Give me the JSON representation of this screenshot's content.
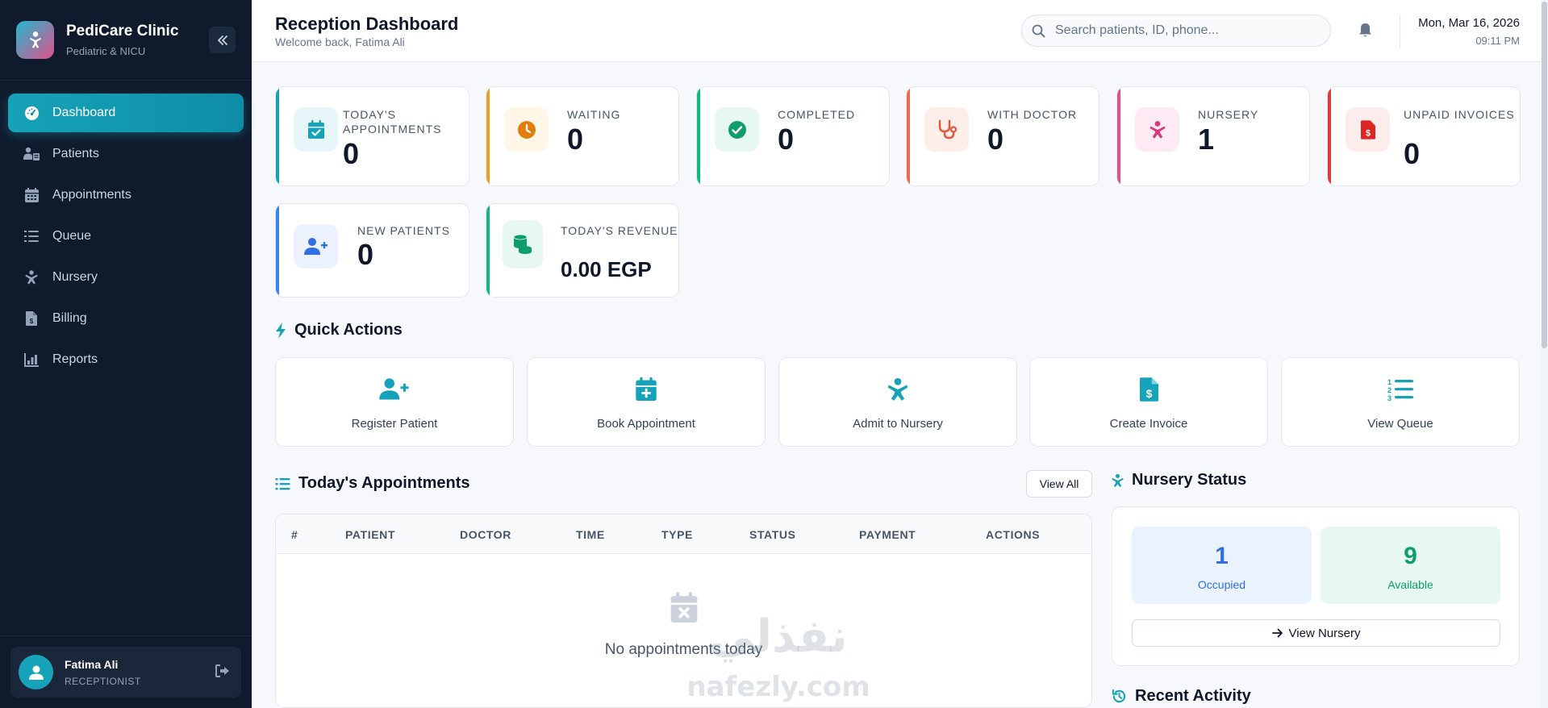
{
  "brand": {
    "name": "PediCare Clinic",
    "subtitle": "Pediatric & NICU"
  },
  "sidebar": {
    "items": [
      {
        "label": "Dashboard",
        "icon": "gauge-icon",
        "active": true
      },
      {
        "label": "Patients",
        "icon": "patients-icon"
      },
      {
        "label": "Appointments",
        "icon": "calendar-icon"
      },
      {
        "label": "Queue",
        "icon": "list-ol-icon"
      },
      {
        "label": "Nursery",
        "icon": "baby-icon"
      },
      {
        "label": "Billing",
        "icon": "invoice-icon"
      },
      {
        "label": "Reports",
        "icon": "chart-icon"
      }
    ]
  },
  "user": {
    "name": "Fatima Ali",
    "role": "RECEPTIONIST"
  },
  "header": {
    "title": "Reception Dashboard",
    "subtitle": "Welcome back, Fatima Ali",
    "search_placeholder": "Search patients, ID, phone...",
    "date": "Mon, Mar 16, 2026",
    "time": "09:11 PM"
  },
  "stats": [
    {
      "label": "Today's Appointments",
      "value": "0",
      "color": "#16a2b8"
    },
    {
      "label": "Waiting",
      "value": "0",
      "color": "#f0a020"
    },
    {
      "label": "Completed",
      "value": "0",
      "color": "#10b981"
    },
    {
      "label": "With Doctor",
      "value": "0",
      "color": "#f06a4a"
    },
    {
      "label": "Nursery",
      "value": "1",
      "color": "#e0508a"
    },
    {
      "label": "Unpaid Invoices",
      "value": "0",
      "color": "#e03a3a"
    },
    {
      "label": "New Patients",
      "value": "0",
      "color": "#3b82f6"
    },
    {
      "label": "Today's Revenue",
      "value": "0.00 EGP",
      "color": "#10b981"
    }
  ],
  "quick_actions": {
    "title": "Quick Actions",
    "items": [
      {
        "label": "Register Patient",
        "icon": "user-plus-icon"
      },
      {
        "label": "Book Appointment",
        "icon": "calendar-plus-icon"
      },
      {
        "label": "Admit to Nursery",
        "icon": "baby-icon"
      },
      {
        "label": "Create Invoice",
        "icon": "invoice-dollar-icon"
      },
      {
        "label": "View Queue",
        "icon": "list-ol-icon"
      }
    ]
  },
  "appointments": {
    "title": "Today's Appointments",
    "view_all": "View All",
    "columns": [
      "#",
      "PATIENT",
      "DOCTOR",
      "TIME",
      "TYPE",
      "STATUS",
      "PAYMENT",
      "ACTIONS"
    ],
    "empty_message": "No appointments today"
  },
  "nursery": {
    "title": "Nursery Status",
    "occupied": {
      "value": "1",
      "label": "Occupied"
    },
    "available": {
      "value": "9",
      "label": "Available"
    },
    "button": "View Nursery"
  },
  "recent_activity": {
    "title": "Recent Activity"
  },
  "watermark": {
    "arabic": "نفذلي",
    "latin": "nafezly.com"
  }
}
